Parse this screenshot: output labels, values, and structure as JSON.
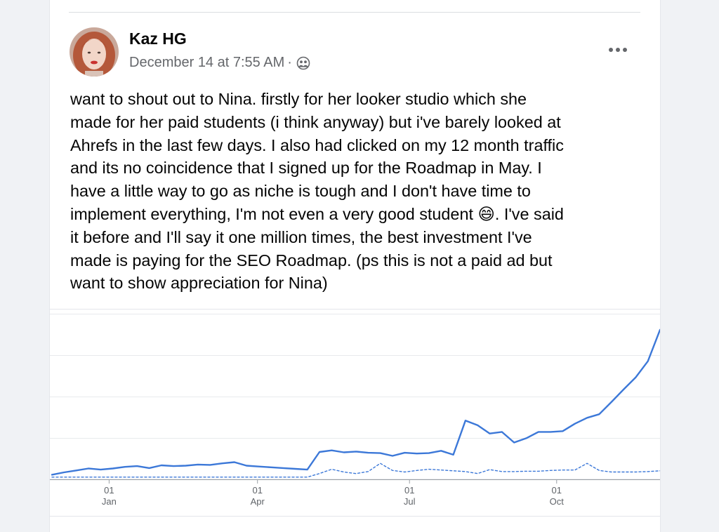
{
  "post": {
    "author": "Kaz HG",
    "date": "December 14 at 7:55 AM",
    "separator": "·",
    "privacy_icon": "friends-icon",
    "more_icon": "more-options-icon",
    "more_label": "•••",
    "text": "want to shout out to Nina. firstly for her looker studio which she\nmade for her paid students (i think anyway) but i've barely looked at\nAhrefs in the last few days. I also had clicked on my 12 month traffic\nand its no coincidence that I signed up for the Roadmap in May. I\nhave a little way to go as niche is tough and I don't have time to\nimplement everything, I'm not even a very good student 😄. I've said\nit before and I'll say it one million times, the best investment I've\nmade is paying for the SEO Roadmap. (ps this is not a paid ad but\nwant to show appreciation for Nina)"
  },
  "chart_data": {
    "type": "line",
    "x_tick_labels": [
      {
        "day": "01",
        "month": "Jan"
      },
      {
        "day": "01",
        "month": "Apr"
      },
      {
        "day": "01",
        "month": "Jul"
      },
      {
        "day": "01",
        "month": "Oct"
      }
    ],
    "gridlines": true,
    "legend": "none",
    "series": [
      {
        "style": "solid",
        "color": "#3c78d8",
        "values": [
          1.0,
          1.6,
          2.1,
          2.6,
          2.3,
          2.6,
          3.0,
          3.2,
          2.7,
          3.4,
          3.2,
          3.3,
          3.6,
          3.5,
          3.9,
          4.2,
          3.3,
          3.1,
          2.9,
          2.7,
          2.5,
          2.3,
          6.8,
          7.2,
          6.7,
          6.9,
          6.6,
          6.5,
          5.8,
          6.6,
          6.4,
          6.5,
          7.1,
          6.1,
          14.8,
          13.6,
          11.5,
          11.9,
          9.2,
          10.3,
          11.9,
          11.9,
          12.1,
          14.0,
          15.5,
          16.4,
          19.5,
          22.7,
          25.8,
          29.9,
          37.9
        ]
      },
      {
        "style": "dashed",
        "color": "#3c78d8",
        "values": [
          0.4,
          0.4,
          0.4,
          0.4,
          0.4,
          0.4,
          0.4,
          0.4,
          0.4,
          0.4,
          0.4,
          0.4,
          0.4,
          0.4,
          0.4,
          0.4,
          0.4,
          0.4,
          0.4,
          0.4,
          0.4,
          0.4,
          1.3,
          2.4,
          1.7,
          1.3,
          1.8,
          3.9,
          2.1,
          1.7,
          2.1,
          2.4,
          2.2,
          2.0,
          1.8,
          1.3,
          2.3,
          1.8,
          1.8,
          1.9,
          1.9,
          2.1,
          2.2,
          2.2,
          3.9,
          2.1,
          1.7,
          1.7,
          1.7,
          1.8,
          2.0
        ]
      }
    ],
    "ylim": [
      0,
      42
    ]
  },
  "colors": {
    "accent": "#3c78d8",
    "text": "#050505",
    "secondary_text": "#65676b",
    "background": "#f0f2f5"
  }
}
